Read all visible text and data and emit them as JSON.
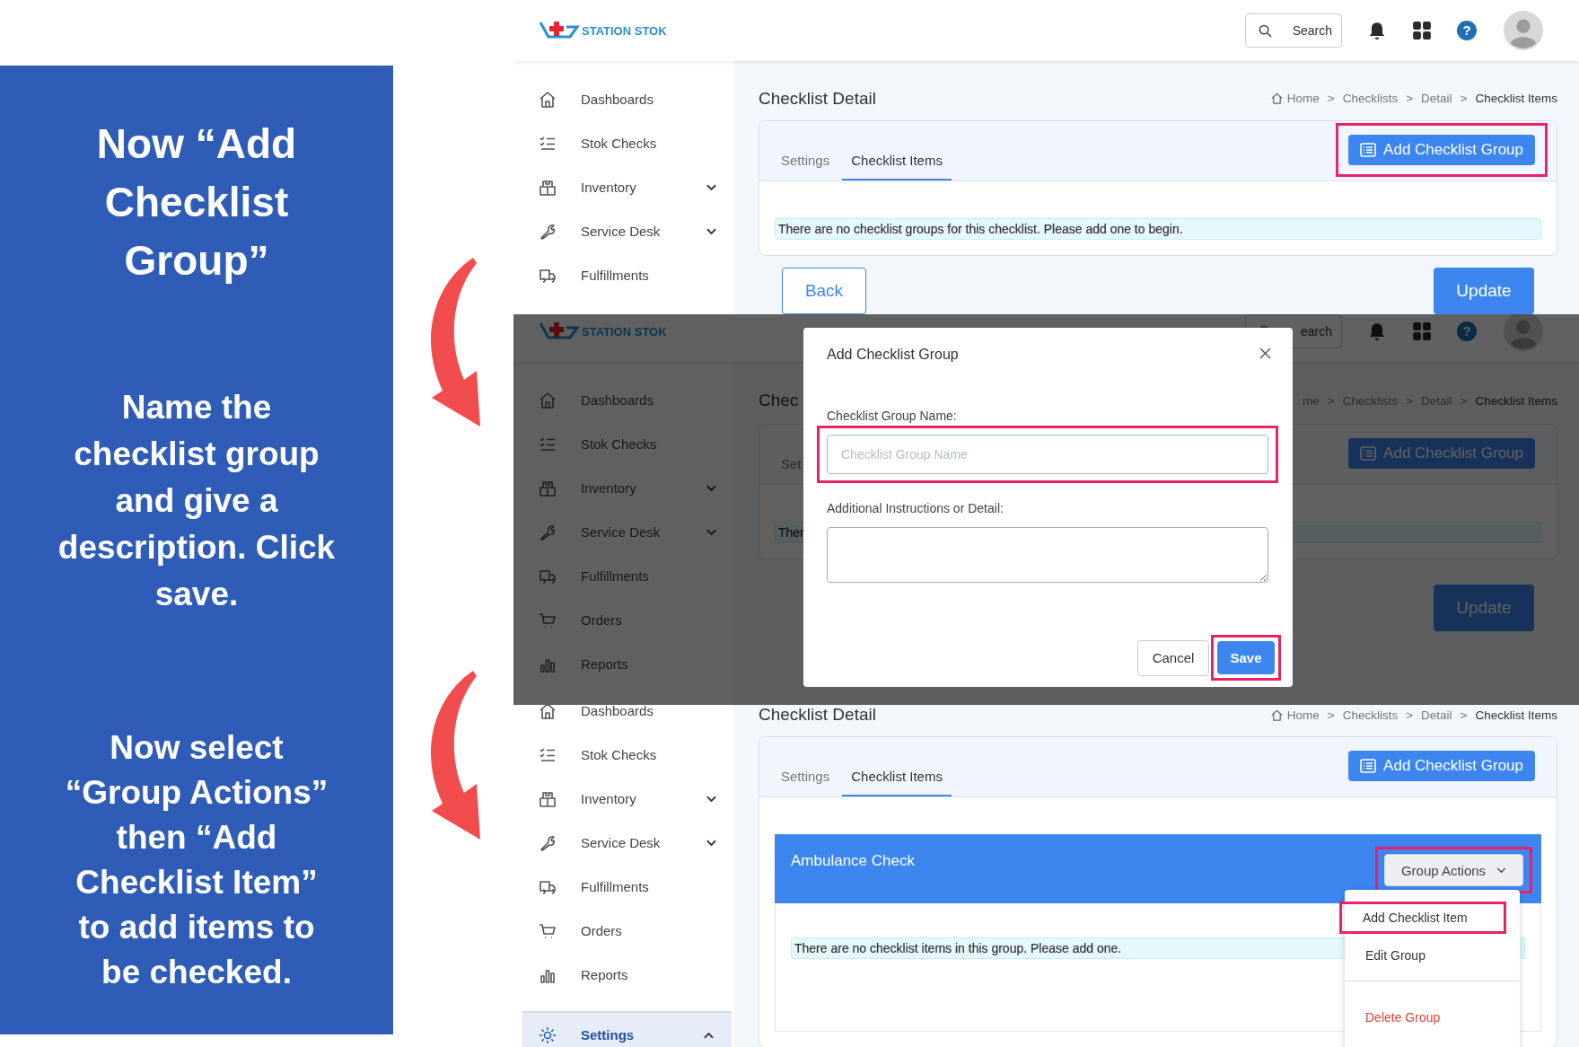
{
  "instructions": [
    "Now “Add Checklist Group”",
    "Name the checklist group and give a description. Click save.",
    "Now select “Group Actions” then “Add Checklist Item” to add items to be checked."
  ],
  "panels": [
    {
      "dimmed": false,
      "header": {
        "logo": "STATION STOK",
        "search": "Search",
        "help": "?"
      },
      "sidebar": [
        {
          "label": "Dashboards",
          "kind": "link",
          "selected": false
        },
        {
          "label": "Stok Checks",
          "kind": "link",
          "selected": false
        },
        {
          "label": "Inventory",
          "kind": "group",
          "expanded": false,
          "selected": false
        },
        {
          "label": "Service Desk",
          "kind": "group",
          "expanded": false,
          "selected": false
        },
        {
          "label": "Fulfillments",
          "kind": "link",
          "selected": false
        }
      ],
      "main": {
        "title": "Checklist Detail",
        "home_icon": true,
        "breadcrumb": [
          "Home",
          "Checklists",
          "Detail",
          "Checklist Items"
        ],
        "breadcrumb_separator": ">",
        "tabs": [
          {
            "label": "Settings",
            "selected": false
          },
          {
            "label": "Checklist Items",
            "selected": true
          }
        ],
        "add_button": {
          "label": "Add Checklist Group",
          "highlighted": true
        },
        "message": "There are no checklist groups for this checklist. Please add one to begin.",
        "back": "Back",
        "update": "Update"
      }
    },
    {
      "dimmed": true,
      "header": {
        "logo": "STATION STOK",
        "search": "earch",
        "help": "?"
      },
      "sidebar": [
        {
          "label": "Dashboards",
          "kind": "link",
          "selected": false
        },
        {
          "label": "Stok Checks",
          "kind": "link",
          "selected": false
        },
        {
          "label": "Inventory",
          "kind": "group",
          "expanded": false,
          "selected": false
        },
        {
          "label": "Service Desk",
          "kind": "group",
          "expanded": false,
          "selected": false
        },
        {
          "label": "Fulfillments",
          "kind": "link",
          "selected": false
        },
        {
          "label": "Orders",
          "kind": "link",
          "selected": false
        },
        {
          "label": "Reports",
          "kind": "link",
          "selected": false
        }
      ],
      "main": {
        "title": "Chec",
        "home_icon": false,
        "breadcrumb": [
          "me",
          "Checklists",
          "Detail",
          "Checklist Items"
        ],
        "breadcrumb_separator": ">",
        "tabs": [
          {
            "label": "Set",
            "selected": false
          }
        ],
        "add_button": {
          "label": "Add Checklist Group",
          "highlighted": false
        },
        "message": "Ther",
        "update": "Update"
      },
      "modal": {
        "title": "Add Checklist Group",
        "fields": [
          {
            "label": "Checklist Group Name:",
            "kind": "input",
            "placeholder": "Checklist Group Name",
            "highlighted": true
          },
          {
            "label": "Additional Instructions or Detail:",
            "kind": "textarea",
            "highlighted": false
          }
        ],
        "cancel": "Cancel",
        "save": {
          "label": "Save",
          "highlighted": true
        }
      }
    },
    {
      "dimmed": false,
      "sidebar": [
        {
          "label": "Dashboards",
          "kind": "link",
          "selected": false
        },
        {
          "label": "Stok Checks",
          "kind": "link",
          "selected": false
        },
        {
          "label": "Inventory",
          "kind": "group",
          "expanded": false,
          "selected": false
        },
        {
          "label": "Service Desk",
          "kind": "group",
          "expanded": false,
          "selected": false
        },
        {
          "label": "Fulfillments",
          "kind": "link",
          "selected": false
        },
        {
          "label": "Orders",
          "kind": "link",
          "selected": false
        },
        {
          "label": "Reports",
          "kind": "link",
          "selected": false
        },
        {
          "label": "Settings",
          "kind": "group",
          "expanded": true,
          "selected": true
        }
      ],
      "main": {
        "title": "Checklist Detail",
        "home_icon": true,
        "breadcrumb": [
          "Home",
          "Checklists",
          "Detail",
          "Checklist Items"
        ],
        "breadcrumb_separator": ">",
        "tabs": [
          {
            "label": "Settings",
            "selected": false
          },
          {
            "label": "Checklist Items",
            "selected": true
          }
        ],
        "add_button": {
          "label": "Add Checklist Group",
          "highlighted": false
        },
        "group": {
          "name": "Ambulance Check",
          "actions": {
            "label": "Group Actions",
            "highlighted": true
          },
          "menu": [
            {
              "label": "Add Checklist Item",
              "kind": "action",
              "highlighted": true
            },
            {
              "label": "Edit Group",
              "kind": "action",
              "highlighted": false
            },
            {
              "label": "Delete Group",
              "kind": "danger",
              "highlighted": false
            }
          ],
          "message": "There are no checklist items in this group. Please add one."
        }
      }
    }
  ]
}
